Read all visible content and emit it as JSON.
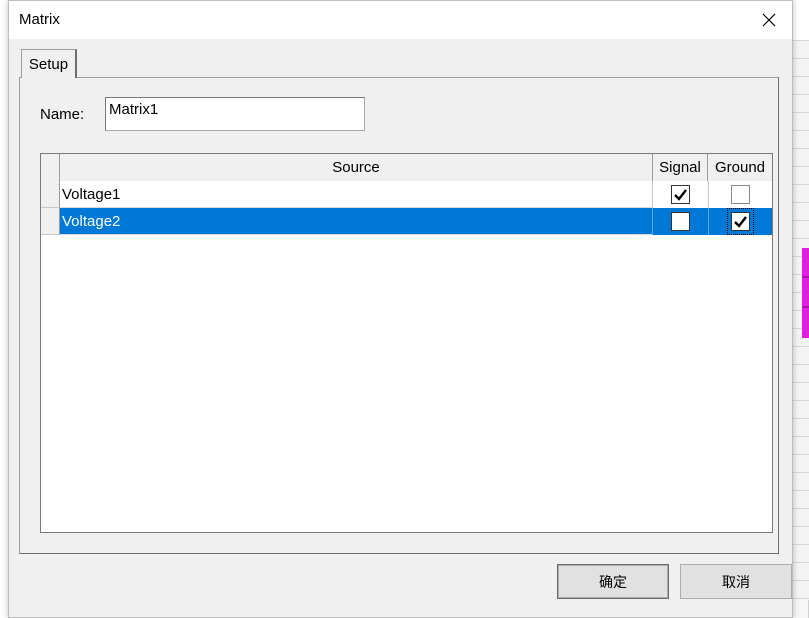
{
  "window": {
    "title": "Matrix"
  },
  "tabs": [
    {
      "label": "Setup"
    }
  ],
  "form": {
    "name_label": "Name:",
    "name_value": "Matrix1"
  },
  "table": {
    "columns": [
      "Source",
      "Signal",
      "Ground"
    ],
    "rows": [
      {
        "source": "Voltage1",
        "signal": true,
        "ground": false,
        "selected": false
      },
      {
        "source": "Voltage2",
        "signal": false,
        "ground": true,
        "selected": true
      }
    ]
  },
  "buttons": {
    "ok": "确定",
    "cancel": "取消"
  },
  "colors": {
    "selection": "#0078d7",
    "dialog_bg": "#f0f0f0"
  },
  "icons": {
    "close": "close-icon",
    "check": "checkmark-icon"
  }
}
